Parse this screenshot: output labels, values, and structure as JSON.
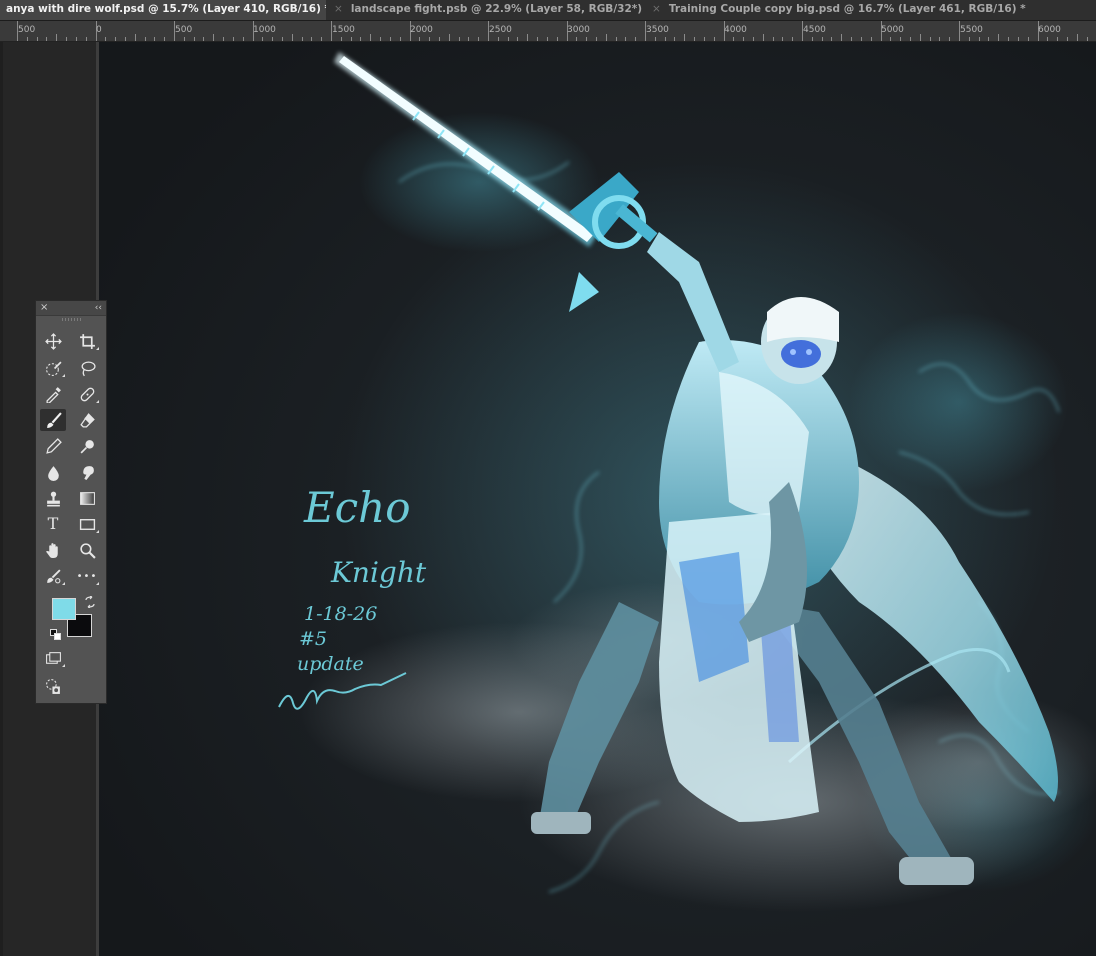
{
  "tabs": [
    {
      "label": "anya with dire wolf.psd @ 15.7% (Layer 410, RGB/16) *",
      "active": true
    },
    {
      "label": "landscape fight.psb @ 22.9% (Layer 58, RGB/32*) *",
      "active": false
    },
    {
      "label": "Training Couple copy big.psd @ 16.7% (Layer 461, RGB/16) *",
      "active": false
    }
  ],
  "tab_close_glyph": "×",
  "ruler": {
    "labels": [
      "500",
      "0",
      "500",
      "1000",
      "1500",
      "2000",
      "2500",
      "3000",
      "3500",
      "4000",
      "4500",
      "5000",
      "5500",
      "6000"
    ]
  },
  "tools_panel": {
    "close_glyph": "×",
    "collapse_glyph": "‹‹",
    "tools": [
      {
        "name": "move-tool",
        "icon": "move-icon"
      },
      {
        "name": "crop-tool",
        "icon": "crop-icon"
      },
      {
        "name": "quick-selection-tool",
        "icon": "quick-selection-icon"
      },
      {
        "name": "lasso-tool",
        "icon": "lasso-icon"
      },
      {
        "name": "eyedropper-tool",
        "icon": "eyedropper-icon"
      },
      {
        "name": "healing-brush-tool",
        "icon": "bandage-icon"
      },
      {
        "name": "brush-tool",
        "icon": "brush-icon",
        "selected": true
      },
      {
        "name": "eraser-tool",
        "icon": "eraser-icon"
      },
      {
        "name": "pencil-tool",
        "icon": "pencil-icon"
      },
      {
        "name": "dodge-tool",
        "icon": "dodge-icon"
      },
      {
        "name": "blur-tool",
        "icon": "drop-icon"
      },
      {
        "name": "smudge-tool",
        "icon": "smudge-icon"
      },
      {
        "name": "clone-stamp-tool",
        "icon": "stamp-icon"
      },
      {
        "name": "gradient-tool",
        "icon": "gradient-icon"
      },
      {
        "name": "type-tool",
        "icon": "type-icon",
        "glyph": "T"
      },
      {
        "name": "rectangle-tool",
        "icon": "rectangle-icon"
      },
      {
        "name": "hand-tool",
        "icon": "hand-icon"
      },
      {
        "name": "zoom-tool",
        "icon": "zoom-icon"
      },
      {
        "name": "edit-toolbar",
        "icon": "brush-edit-icon"
      },
      {
        "name": "more-tools",
        "icon": "ellipsis-icon",
        "glyph": "•••"
      }
    ],
    "foreground_color": "#7fdbe8",
    "background_color": "#0b0b0d"
  },
  "artwork": {
    "signature_lines": [
      "Echo",
      "Knight",
      "1-18-26",
      "#5",
      "update"
    ],
    "text_color": "#6cc9d6",
    "background_color": "#16191c",
    "glow_color": "#58d8f0"
  },
  "colors": {
    "tabbar_bg": "#2f2f2f",
    "active_tab_bg": "#454545",
    "ruler_bg": "#3a3a3a",
    "panel_bg": "#535353"
  }
}
